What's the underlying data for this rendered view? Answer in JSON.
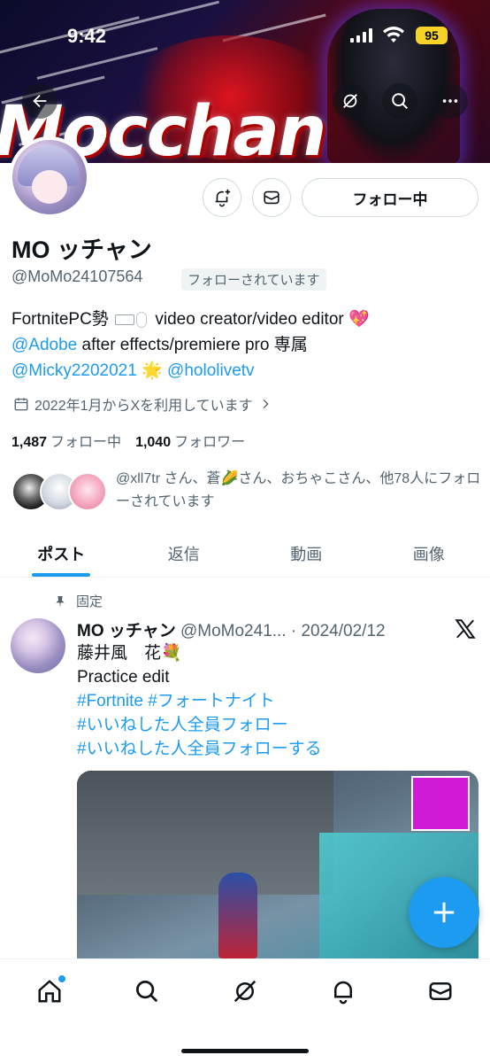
{
  "status": {
    "time": "9:42",
    "battery": "95"
  },
  "banner": {
    "text": "Mocchan"
  },
  "profile": {
    "name": "MO ッチャン",
    "handle": "@MoMo24107564",
    "follows_you": "フォローされています",
    "follow_button": "フォロー中",
    "bio": {
      "line1_a": "FortnitePC勢",
      "line1_b": "video creator/video editor",
      "heart": "💖",
      "adobe_link": "@Adobe",
      "line2_rest": " after effects/premiere pro 専属",
      "micky_link": "@Micky2202021",
      "star": "🌟",
      "hololive_link": "@hololivetv"
    },
    "joined": "2022年1月からXを利用しています",
    "following_count": "1,487",
    "following_label": "フォロー中",
    "followers_count": "1,040",
    "followers_label": "フォロワー",
    "mutuals_text": "@xll7tr さん、蒼🌽さん、おちゃこさん、他78人にフォローされています"
  },
  "tabs": [
    {
      "label": "ポスト",
      "active": true
    },
    {
      "label": "返信",
      "active": false
    },
    {
      "label": "動画",
      "active": false
    },
    {
      "label": "画像",
      "active": false
    }
  ],
  "post": {
    "pinned_label": "固定",
    "author": "MO ッチャン",
    "handle_date": "@MoMo241... · 2024/02/12",
    "line1": "藤井風　花💐",
    "line2": "Practice edit",
    "tags1": "#Fortnite #フォートナイト",
    "tags2": "#いいねした人全員フォロー",
    "tags3": "#いいねした人全員フォローする"
  },
  "icons": {
    "back": "arrow-left-icon",
    "grok": "grok-icon",
    "search": "search-icon",
    "more": "more-icon",
    "notify": "bell-plus-icon",
    "message": "envelope-icon",
    "calendar": "calendar-icon",
    "pin": "pin-icon",
    "x": "x-logo-icon",
    "compose": "plus-icon"
  },
  "colors": {
    "accent": "#1d9bf0",
    "text": "#0f1419",
    "muted": "#536471"
  }
}
